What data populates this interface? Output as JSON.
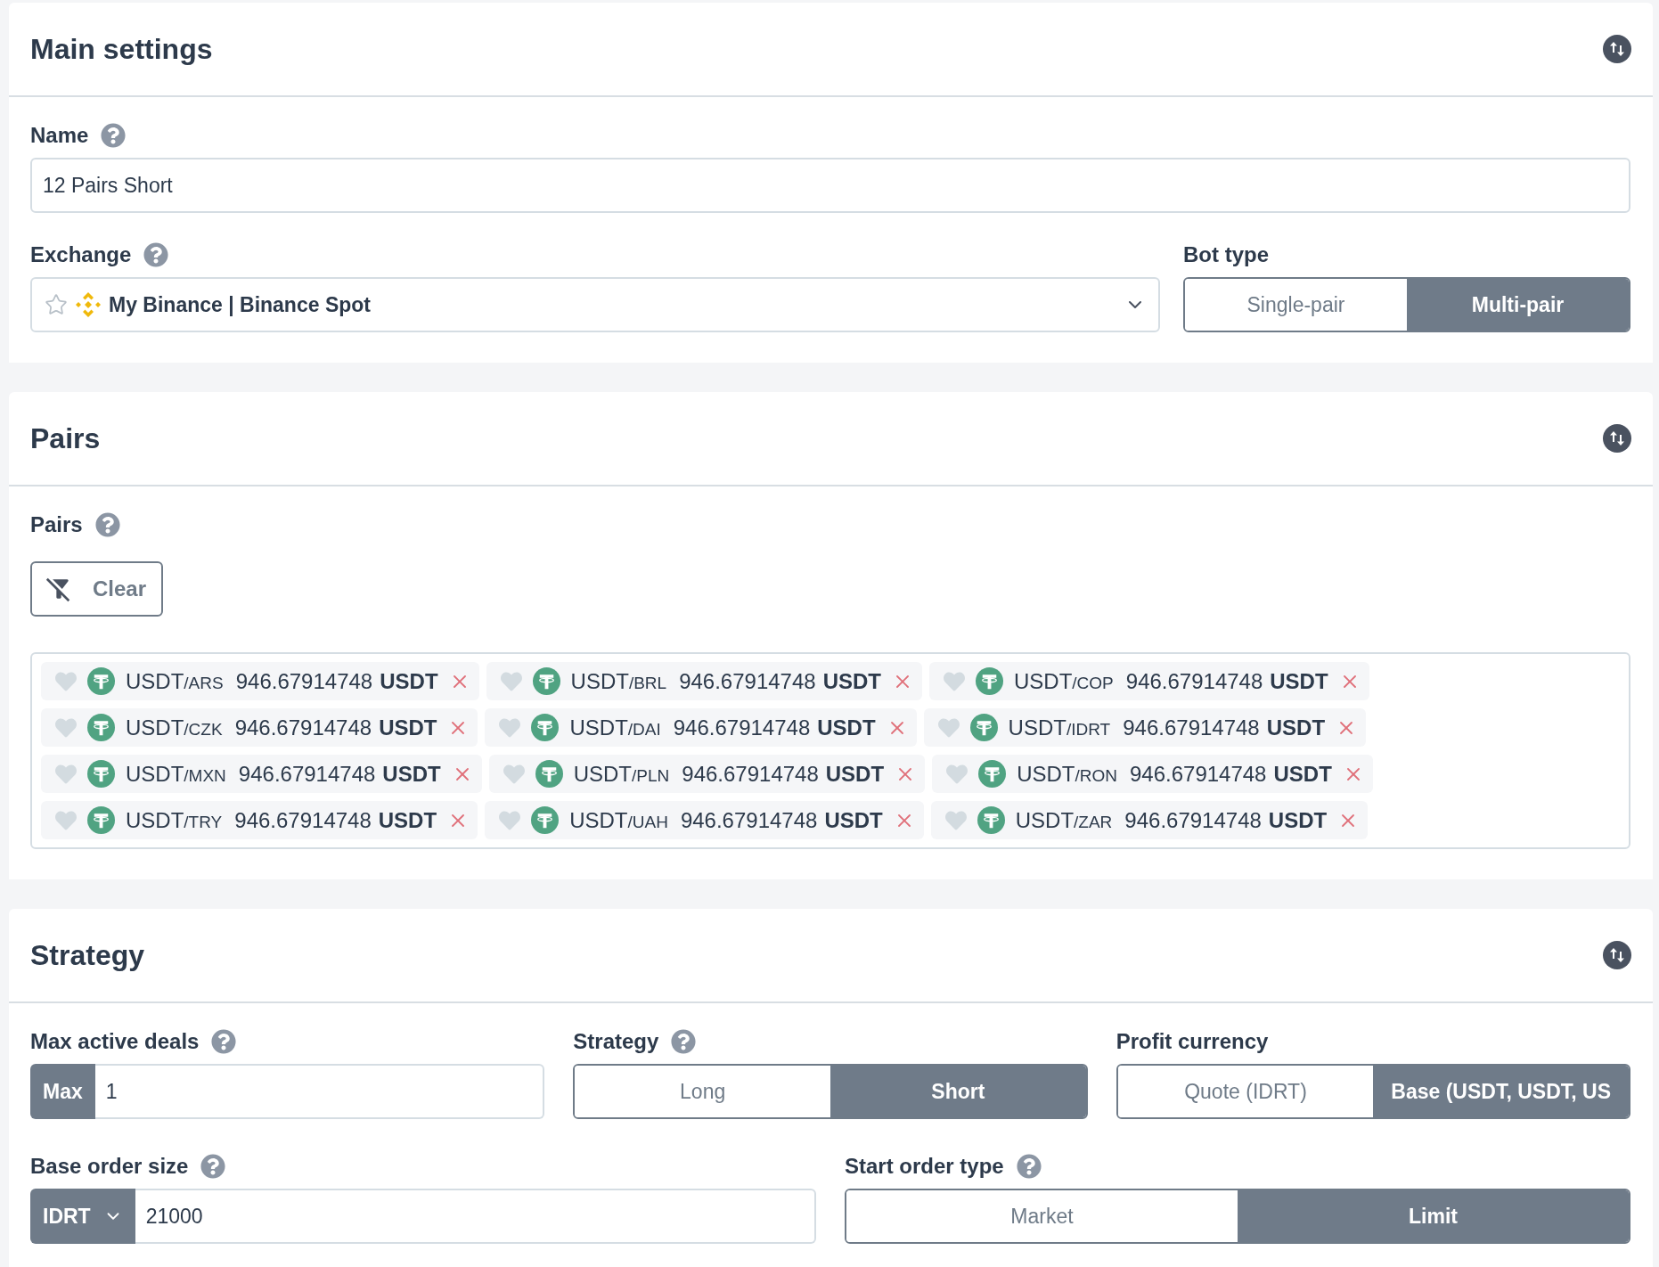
{
  "main_settings": {
    "title": "Main settings",
    "name_field": {
      "label": "Name",
      "help": true,
      "value": "12 Pairs Short"
    },
    "exchange": {
      "label": "Exchange",
      "help": true,
      "value": "My Binance | Binance Spot"
    },
    "bot_type": {
      "label": "Bot type",
      "help": false,
      "options": [
        {
          "label": "Single-pair",
          "selected": false
        },
        {
          "label": "Multi-pair",
          "selected": true
        }
      ]
    }
  },
  "pairs_section": {
    "title": "Pairs",
    "pairs_field": {
      "label": "Pairs",
      "help": true
    },
    "clear_button": "Clear",
    "pairs": [
      {
        "base": "USDT",
        "quote": "/ARS",
        "amount": "946.67914748",
        "currency": "USDT"
      },
      {
        "base": "USDT",
        "quote": "/BRL",
        "amount": "946.67914748",
        "currency": "USDT"
      },
      {
        "base": "USDT",
        "quote": "/COP",
        "amount": "946.67914748",
        "currency": "USDT"
      },
      {
        "base": "USDT",
        "quote": "/CZK",
        "amount": "946.67914748",
        "currency": "USDT"
      },
      {
        "base": "USDT",
        "quote": "/DAI",
        "amount": "946.67914748",
        "currency": "USDT"
      },
      {
        "base": "USDT",
        "quote": "/IDRT",
        "amount": "946.67914748",
        "currency": "USDT"
      },
      {
        "base": "USDT",
        "quote": "/MXN",
        "amount": "946.67914748",
        "currency": "USDT"
      },
      {
        "base": "USDT",
        "quote": "/PLN",
        "amount": "946.67914748",
        "currency": "USDT"
      },
      {
        "base": "USDT",
        "quote": "/RON",
        "amount": "946.67914748",
        "currency": "USDT"
      },
      {
        "base": "USDT",
        "quote": "/TRY",
        "amount": "946.67914748",
        "currency": "USDT"
      },
      {
        "base": "USDT",
        "quote": "/UAH",
        "amount": "946.67914748",
        "currency": "USDT"
      },
      {
        "base": "USDT",
        "quote": "/ZAR",
        "amount": "946.67914748",
        "currency": "USDT"
      }
    ]
  },
  "strategy_section": {
    "title": "Strategy",
    "max_active_deals": {
      "label": "Max active deals",
      "help": true,
      "prefix": "Max",
      "value": "1"
    },
    "strategy": {
      "label": "Strategy",
      "help": true,
      "options": [
        {
          "label": "Long",
          "selected": false
        },
        {
          "label": "Short",
          "selected": true
        }
      ]
    },
    "profit_currency": {
      "label": "Profit currency",
      "help": false,
      "options": [
        {
          "label": "Quote (IDRT)",
          "selected": false
        },
        {
          "label": "Base (USDT, USDT, US",
          "selected": true
        }
      ]
    },
    "base_order_size": {
      "label": "Base order size",
      "help": true,
      "currency": "IDRT",
      "value": "21000"
    },
    "start_order_type": {
      "label": "Start order type",
      "help": true,
      "options": [
        {
          "label": "Market",
          "selected": false
        },
        {
          "label": "Limit",
          "selected": true
        }
      ]
    }
  }
}
